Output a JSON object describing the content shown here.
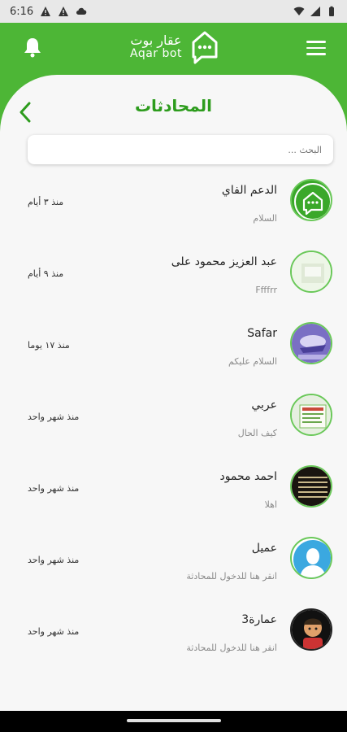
{
  "statusbar": {
    "time": "6:16"
  },
  "header": {
    "logo_ar": "عقار بوت",
    "logo_en": "Aqar bot"
  },
  "page": {
    "title": "المحادثات"
  },
  "search": {
    "placeholder": "البحث ..."
  },
  "conversations": [
    {
      "name": "الدعم الفاي",
      "message": "السلام",
      "time": "منذ ٣ أيام",
      "avatar": "aqar-logo-avatar"
    },
    {
      "name": "عبد العزيز محمود على",
      "message": "Ffffrr",
      "time": "منذ ٩ أيام",
      "avatar": "photo-avatar"
    },
    {
      "name": "Safar",
      "message": "السلام عليكم",
      "time": "منذ ١٧ يوما",
      "avatar": "photo-avatar"
    },
    {
      "name": "عربي",
      "message": "كيف الحال",
      "time": "منذ شهر واحد",
      "avatar": "photo-avatar"
    },
    {
      "name": "احمد محمود",
      "message": "اهلا",
      "time": "منذ شهر واحد",
      "avatar": "photo-avatar"
    },
    {
      "name": "عميل",
      "message": "انقر هنا للدخول للمحادثة",
      "time": "منذ شهر واحد",
      "avatar": "user-icon-avatar"
    },
    {
      "name": "عمارة3",
      "message": "انقر هنا للدخول للمحادثة",
      "time": "منذ شهر واحد",
      "avatar": "character-avatar"
    }
  ],
  "colors": {
    "brand_green": "#4db636",
    "title_green": "#2d9c1d"
  }
}
